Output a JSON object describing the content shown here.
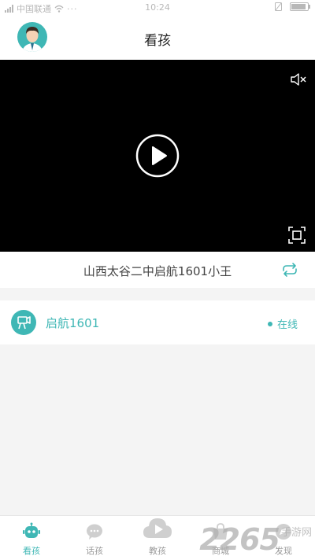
{
  "status_bar": {
    "carrier": "中国联通",
    "time": "10:24"
  },
  "header": {
    "title": "看孩"
  },
  "video": {
    "state": "paused"
  },
  "channel": {
    "name": "山西太谷二中启航1601小王"
  },
  "device": {
    "name": "启航1601",
    "status": "在线"
  },
  "tabs": [
    {
      "label": "看孩",
      "icon": "robot-icon",
      "active": true
    },
    {
      "label": "话孩",
      "icon": "chat-icon",
      "active": false
    },
    {
      "label": "教孩",
      "icon": "cloud-play-icon",
      "active": false
    },
    {
      "label": "商城",
      "icon": "shop-icon",
      "active": false
    },
    {
      "label": "发现",
      "icon": "discover-icon",
      "active": false
    }
  ],
  "watermark": {
    "number": "2265",
    "site": "手游网"
  },
  "colors": {
    "accent": "#3fb7b5",
    "video_bg": "#000000",
    "inactive": "#9a9a9a"
  }
}
